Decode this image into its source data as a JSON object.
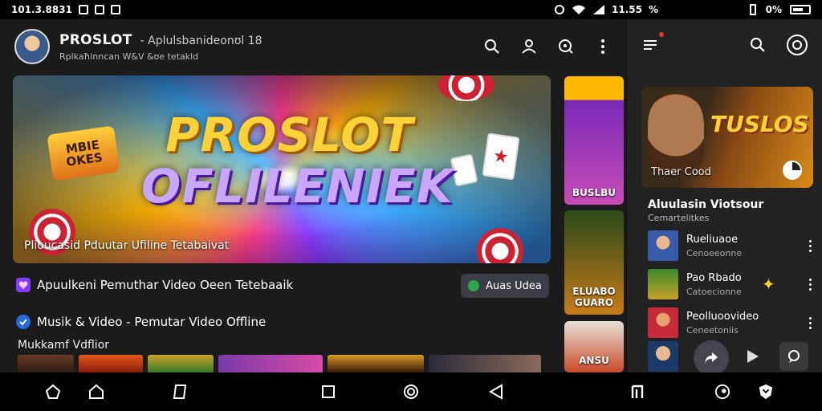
{
  "status_bar": {
    "left_text": "101.3.8831",
    "mid_text": "11.55",
    "mid_percent": "%",
    "right_percent": "0%"
  },
  "header": {
    "title": "PROSLOT",
    "title_sub": "- Aplulsbanideonʊl 18",
    "subtitle": "Rplkaħinncan W&V &ʊe tetakld",
    "actions": [
      "search-icon",
      "account-icon",
      "refresh-search-icon",
      "more-vert-icon"
    ]
  },
  "hero": {
    "title_line1": "PROSLOT",
    "title_line2": "OFLILENIEK",
    "badge_text": "MBIE OKES",
    "caption": "Plioucasid Pduutar Ufiline Tetabaivat",
    "card_symbol": "★"
  },
  "rows": {
    "row1_text": "Apuulkeni Pemuthar Video Oeen Tetebaaik",
    "row1_action": "Auas Udea",
    "row2_text": "Musik & Video - Pemutar Video Offline"
  },
  "section_label": "Mukkamf Vdflior",
  "posters": [
    {
      "label": ""
    },
    {
      "label": "BUSLBU"
    },
    {
      "label": "ELUABO GUARO"
    },
    {
      "label": "ANSU"
    }
  ],
  "right_panel": {
    "feature_title": "TUSLOS",
    "feature_caption": "Thaer Cood",
    "section_title": "Aluulasin Viotsour",
    "section_sub": "Cemartelitkes",
    "list": [
      {
        "title": "Rueliuaoe",
        "sub": "Cenoeeonne"
      },
      {
        "title": "Pao Rbado",
        "sub": "Catoecionne"
      },
      {
        "title": "Peolluoovideo",
        "sub": "Ceneetoniis"
      }
    ]
  },
  "colors": {
    "accent_gold": "#ffd23a",
    "accent_purple": "#c9a6ff",
    "chip_green": "#2ea84a",
    "panel_bg": "#222222"
  }
}
